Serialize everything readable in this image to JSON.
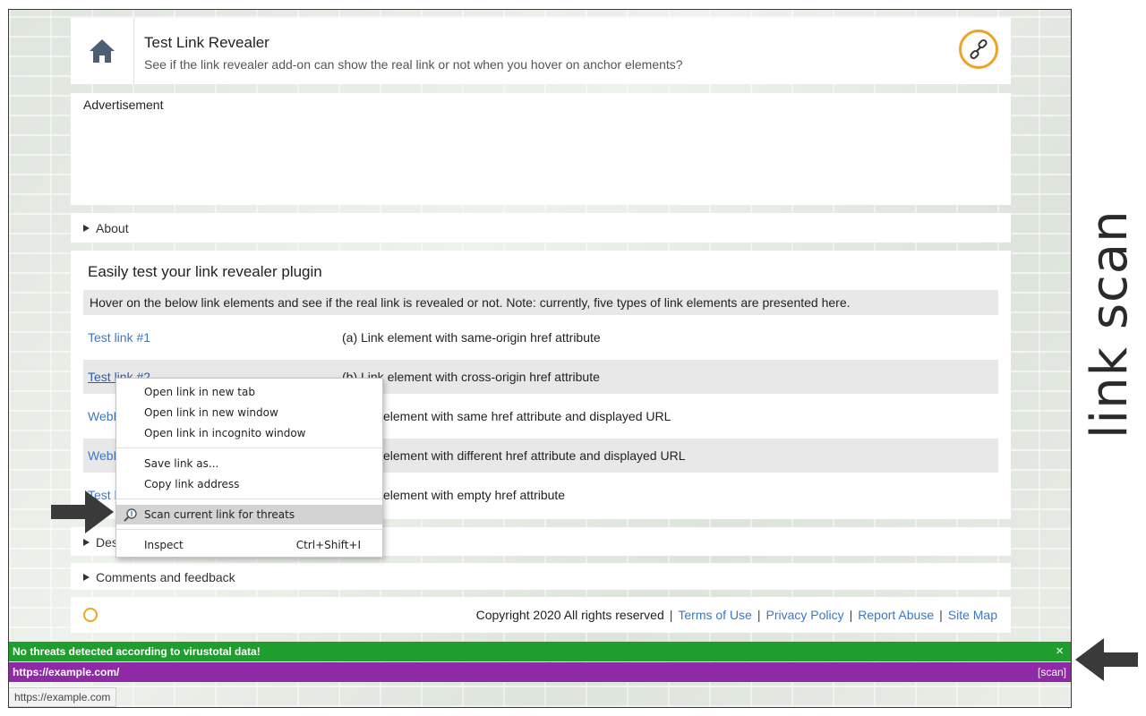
{
  "header": {
    "title": "Test Link Revealer",
    "subtitle": "See if the link revealer add-on can show the real link or not when you hover on anchor elements?",
    "home_icon": "home-icon",
    "logo_icon": "link-icon"
  },
  "ad": {
    "label": "Advertisement"
  },
  "about": {
    "label": "About"
  },
  "main": {
    "title": "Easily test your link revealer plugin",
    "note": "Hover on the below link elements and see if the real link is revealed or not. Note: currently, five types of link elements are presented here.",
    "rows": [
      {
        "link": "Test link #1",
        "desc": "(a) Link element with same-origin href attribute"
      },
      {
        "link": "Test link #2",
        "desc": "(b) Link element with cross-origin href attribute"
      },
      {
        "link": "WebE",
        "desc": "element with same href attribute and displayed URL"
      },
      {
        "link": "WebE",
        "desc": "element with different href attribute and displayed URL"
      },
      {
        "link": "Test l",
        "desc": "element with empty href attribute"
      }
    ]
  },
  "desc_section": {
    "label": "Des"
  },
  "comments": {
    "label": "Comments and feedback"
  },
  "footer": {
    "copyright": "Copyright 2020 All rights reserved",
    "links": [
      "Terms of Use",
      "Privacy Policy",
      "Report Abuse",
      "Site Map"
    ]
  },
  "context_menu": {
    "items": [
      {
        "label": "Open link in new tab"
      },
      {
        "label": "Open link in new window"
      },
      {
        "label": "Open link in incognito window"
      },
      {
        "label": "Save link as..."
      },
      {
        "label": "Copy link address"
      },
      {
        "label": "Scan current link for threats",
        "icon": "magnifier-icon"
      },
      {
        "label": "Inspect",
        "shortcut": "Ctrl+Shift+I"
      }
    ]
  },
  "extension": {
    "status_message": "No threats detected according to virustotal data!",
    "close_label": "×",
    "url": "https://example.com/",
    "scan_label": "[scan]"
  },
  "statusbar": {
    "url": "https://example.com"
  },
  "side_label": "link scan",
  "colors": {
    "green_bar": "#1f9e2d",
    "purple_bar": "#8e2aa6",
    "link": "#3a78c9",
    "accent": "#f0a323"
  }
}
